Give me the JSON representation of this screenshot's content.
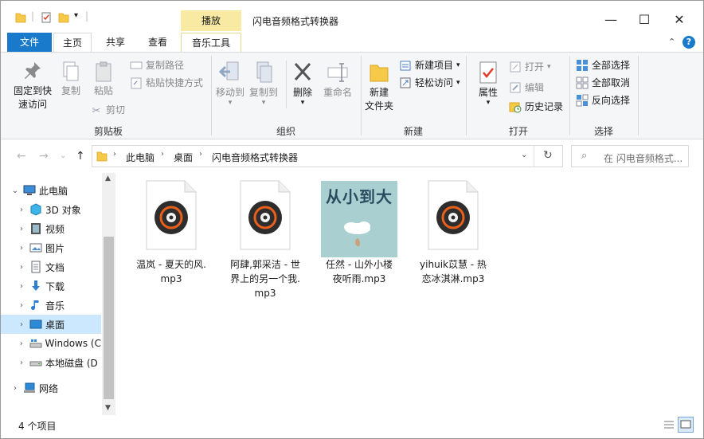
{
  "window": {
    "title": "闪电音频格式转换器",
    "context_tab": "播放",
    "controls": {
      "minimize": "—",
      "maximize": "☐",
      "close": "✕"
    }
  },
  "tabs": {
    "file": "文件",
    "home": "主页",
    "share": "共享",
    "view": "查看",
    "music_tools": "音乐工具"
  },
  "ribbon": {
    "clipboard": {
      "pin_line1": "固定到快",
      "pin_line2": "速访问",
      "copy": "复制",
      "paste": "粘贴",
      "copy_path": "复制路径",
      "paste_shortcut": "粘贴快捷方式",
      "cut": "剪切",
      "label": "剪贴板"
    },
    "organize": {
      "move_to": "移动到",
      "copy_to": "复制到",
      "delete": "删除",
      "rename": "重命名",
      "label": "组织"
    },
    "new": {
      "new_folder_line1": "新建",
      "new_folder_line2": "文件夹",
      "new_item": "新建项目",
      "easy_access": "轻松访问",
      "label": "新建"
    },
    "open": {
      "properties": "属性",
      "open": "打开",
      "edit": "编辑",
      "history": "历史记录",
      "label": "打开"
    },
    "select": {
      "select_all": "全部选择",
      "select_none": "全部取消",
      "invert": "反向选择",
      "label": "选择"
    }
  },
  "address": {
    "crumbs": [
      "此电脑",
      "桌面",
      "闪电音频格式转换器"
    ],
    "search_placeholder": "在 闪电音频格式..."
  },
  "nav": {
    "items": [
      {
        "label": "此电脑",
        "icon": "pc-icon"
      },
      {
        "label": "3D 对象",
        "icon": "cube-icon"
      },
      {
        "label": "视频",
        "icon": "video-icon"
      },
      {
        "label": "图片",
        "icon": "picture-icon"
      },
      {
        "label": "文档",
        "icon": "document-icon"
      },
      {
        "label": "下载",
        "icon": "download-icon"
      },
      {
        "label": "音乐",
        "icon": "music-icon"
      },
      {
        "label": "桌面",
        "icon": "desktop-icon"
      },
      {
        "label": "Windows (C",
        "icon": "drive-icon"
      },
      {
        "label": "本地磁盘 (D",
        "icon": "disk-icon"
      },
      {
        "label": "网络",
        "icon": "network-icon"
      }
    ]
  },
  "files": [
    {
      "name_line1": "温岚 - 夏天的风.",
      "name_line2": "mp3",
      "name_line3": "",
      "icon": "music-file-icon"
    },
    {
      "name_line1": "阿肆,郭采洁 - 世",
      "name_line2": "界上的另一个我.",
      "name_line3": "mp3",
      "icon": "music-file-icon"
    },
    {
      "name_line1": "任然 - 山外小楼",
      "name_line2": "夜听雨.mp3",
      "name_line3": "",
      "icon": "album-cover-thumbnail",
      "cover_text": "从小到大"
    },
    {
      "name_line1": "yihuik苡慧 - 热",
      "name_line2": "恋冰淇淋.mp3",
      "name_line3": "",
      "icon": "music-file-icon"
    }
  ],
  "status": {
    "count": "4 个项目"
  },
  "colors": {
    "accent": "#1979ca",
    "context_tab": "#f8eaa3",
    "selected": "#cce8ff"
  }
}
